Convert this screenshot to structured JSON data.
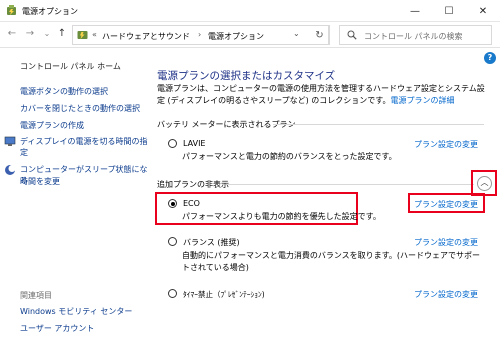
{
  "window": {
    "title": "電源オプション",
    "min_symbol": "—",
    "max_symbol": "☐",
    "close_symbol": "✕"
  },
  "nav": {
    "back_symbol": "←",
    "forward_symbol": "→",
    "recent_symbol": "⌄",
    "up_symbol": "↑",
    "refresh_symbol": "↻"
  },
  "address": {
    "prefix": "«",
    "segments": [
      "ハードウェアとサウンド",
      "電源オプション"
    ],
    "separator": "›",
    "dropdown_symbol": "⌄"
  },
  "search": {
    "placeholder": "コントロール パネルの検索"
  },
  "help_symbol": "?",
  "sidebar": {
    "home": "コントロール パネル ホーム",
    "links": [
      "電源ボタンの動作の選択",
      "カバーを閉じたときの動作の選択",
      "電源プランの作成",
      "ディスプレイの電源を切る時間の指定",
      "コンピューターがスリープ状態になる",
      "時間を変更"
    ],
    "related_heading": "関連項目",
    "related": [
      "Windows モビリティ センター",
      "ユーザー アカウント"
    ]
  },
  "main": {
    "title": "電源プランの選択またはカスタマイズ",
    "description": "電源プランは、コンピューターの電源の使用方法を管理するハードウェア設定とシステム設定 (ディスプレイの明るさやスリープなど) のコレクションです。",
    "description_link": "電源プランの詳細",
    "battery_section": "バッテリ メーターに表示されるプラン",
    "additional_section": "追加プランの非表示",
    "collapse_symbol": "︿",
    "change_label": "プラン設定の変更",
    "plans": [
      {
        "name": "LAVIE",
        "desc": "パフォーマンスと電力の節約のバランスをとった設定です。",
        "selected": false
      },
      {
        "name": "ECO",
        "desc": "パフォーマンスよりも電力の節約を優先した設定です。",
        "selected": true
      },
      {
        "name": "バランス (推奨)",
        "desc": "自動的にパフォーマンスと電力消費のバランスを取ります。(ハードウェアでサポートされている場合)",
        "selected": false
      },
      {
        "name": "ﾀｲﾏｰ禁止（ﾌﾟﾚｾﾞﾝﾃｰｼｮﾝ)",
        "desc": "",
        "selected": false
      }
    ]
  },
  "colors": {
    "accent": "#0066cc",
    "title_blue": "#1e3287",
    "highlight_red": "#e8001c"
  }
}
